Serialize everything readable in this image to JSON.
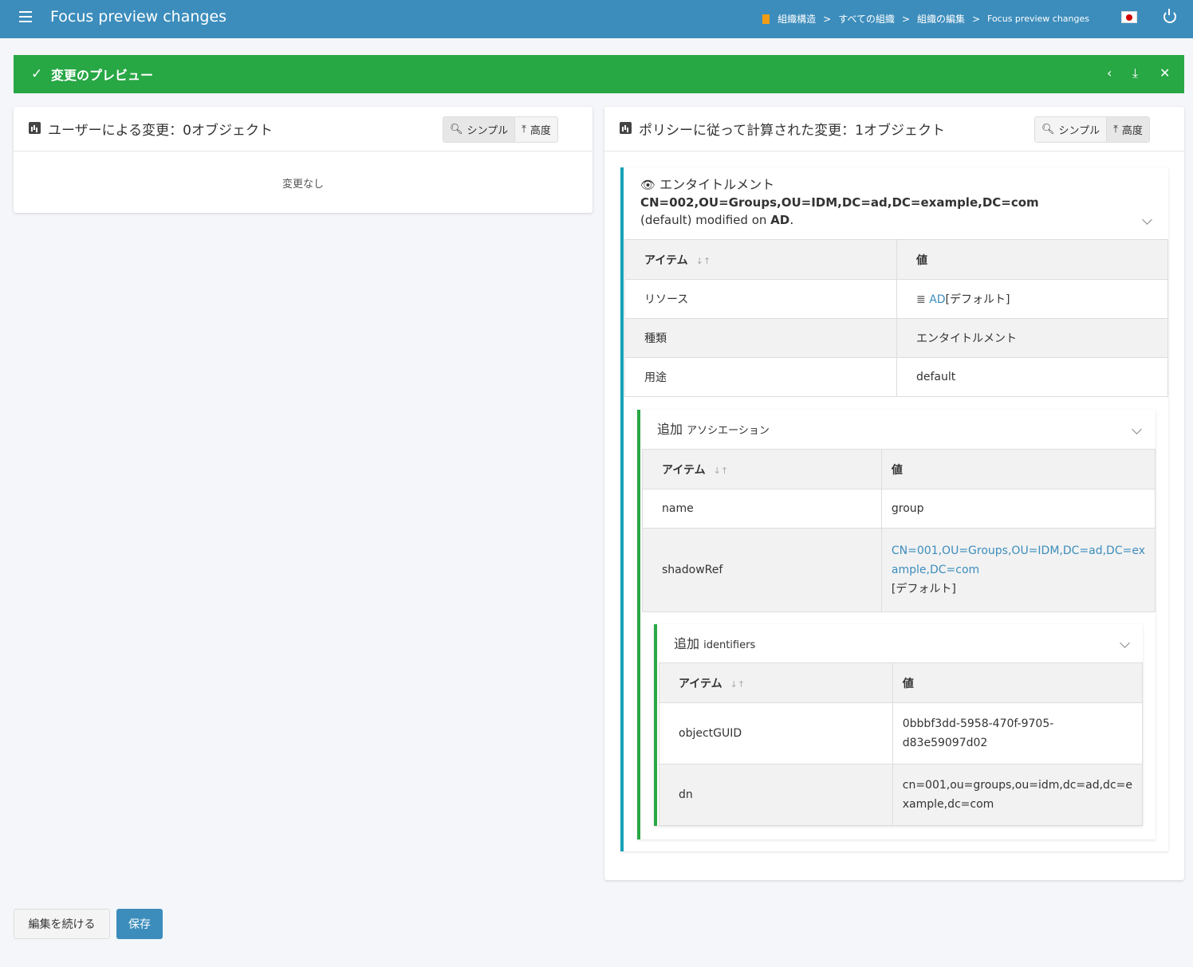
{
  "header": {
    "title": "Focus preview changes",
    "breadcrumb": [
      "組織構造",
      "すべての組織",
      "組織の編集",
      "Focus preview changes"
    ]
  },
  "banner": {
    "title": "変更のプレビュー"
  },
  "left_card": {
    "title": "ユーザーによる変更：0オブジェクト",
    "simple_label": "シンプル",
    "advanced_label": "高度",
    "empty_text": "変更なし"
  },
  "right_card": {
    "title": "ポリシーに従って計算された変更：1オブジェクト",
    "simple_label": "シンプル",
    "advanced_label": "高度"
  },
  "entitlement": {
    "kind_label": "エンタイトルメント",
    "dn": "CN=002,OU=Groups,OU=IDM,DC=ad,DC=example,DC=com",
    "suffix_pre": "(default) modified on ",
    "resource_bold": "AD",
    "suffix_post": ".",
    "col_item": "アイテム",
    "col_value": "値",
    "rows": {
      "resource_label": "リソース",
      "resource_link": "AD",
      "resource_suffix": "[デフォルト]",
      "kind_row_label": "種類",
      "kind_row_value": "エンタイトルメント",
      "intent_label": "用途",
      "intent_value": "default"
    }
  },
  "association": {
    "add_label": "追加",
    "name": "アソシエーション",
    "col_item": "アイテム",
    "col_value": "値",
    "name_label": "name",
    "name_value": "group",
    "shadow_label": "shadowRef",
    "shadow_link_1": "CN=001,OU=Groups,OU=IDM,DC=ad,DC=ex",
    "shadow_link_2": "ample,DC=com",
    "shadow_suffix": "[デフォルト]"
  },
  "identifiers": {
    "add_label": "追加",
    "name": "identifiers",
    "col_item": "アイテム",
    "col_value": "値",
    "guid_label": "objectGUID",
    "guid_value_1": "0bbbf3dd-5958-470f-9705-",
    "guid_value_2": "d83e59097d02",
    "dn_label": "dn",
    "dn_value_1": "cn=001,ou=groups,ou=idm,dc=ad,dc=e",
    "dn_value_2": "xample,dc=com"
  },
  "footer": {
    "continue_label": "編集を続ける",
    "save_label": "保存"
  },
  "colors": {
    "header": "#3c8dbc",
    "banner": "#28a745",
    "teal_border": "#17a2b8",
    "link": "#3c8dbc"
  }
}
